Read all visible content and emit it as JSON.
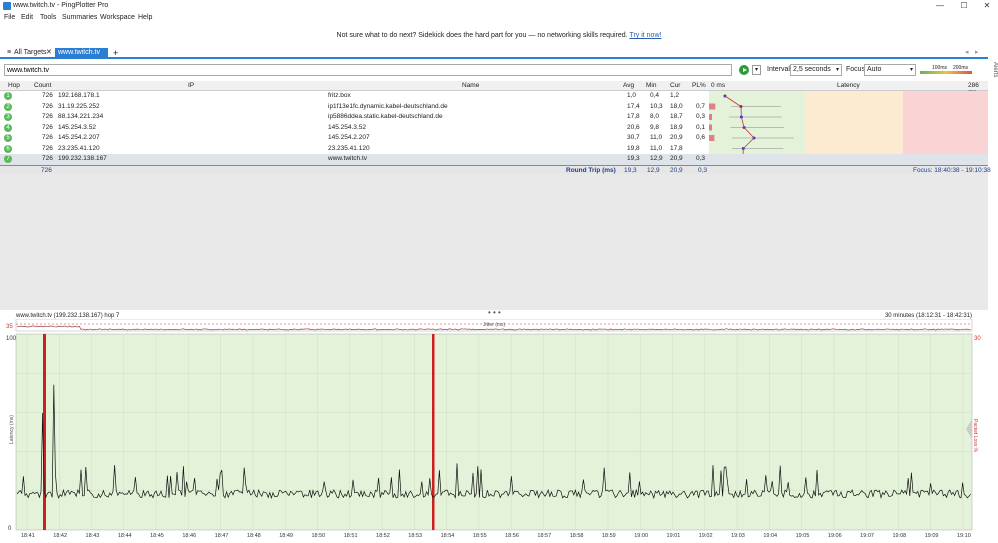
{
  "window": {
    "title": "www.twitch.tv - PingPlotter Pro",
    "controls": [
      "—",
      "☐",
      "✕"
    ]
  },
  "menu": [
    "File",
    "Edit",
    "Tools",
    "Summaries",
    "Workspace",
    "Help"
  ],
  "banner": {
    "text": "Not sure what to do next? Sidekick does the hard part for you — no networking skills required.",
    "link": "Try it now!"
  },
  "tabs": {
    "all_targets": "All Targets",
    "close": "✕",
    "active": "www.twitch.tv",
    "check": "✓",
    "add": "+"
  },
  "alerts": "Alerts",
  "toolbar": {
    "target": "www.twitch.tv",
    "interval_label": "Interval",
    "interval_value": "2,5 seconds",
    "focus_label": "Focus",
    "focus_value": "Auto",
    "scale_100": "100ms",
    "scale_200": "200ms"
  },
  "columns": {
    "hop": "Hop",
    "count": "Count",
    "ip": "IP",
    "name": "Name",
    "avg": "Avg",
    "min": "Min",
    "cur": "Cur",
    "pl": "PL%",
    "zero": "0 ms",
    "latency": "Latency",
    "max": "286 ms"
  },
  "hops": [
    {
      "hop": "1",
      "count": "726",
      "ip": "192.168.178.1",
      "name": "fritz.box",
      "avg": "1,0",
      "min": "0,4",
      "cur": "1,2",
      "pl": ""
    },
    {
      "hop": "2",
      "count": "726",
      "ip": "31.19.225.252",
      "name": "ip1f13e1fc.dynamic.kabel-deutschland.de",
      "avg": "17,4",
      "min": "10,3",
      "cur": "18,0",
      "pl": "0,7"
    },
    {
      "hop": "3",
      "count": "726",
      "ip": "88.134.221.234",
      "name": "ip5886ddea.static.kabel-deutschland.de",
      "avg": "17,8",
      "min": "8,0",
      "cur": "18,7",
      "pl": "0,3"
    },
    {
      "hop": "4",
      "count": "726",
      "ip": "145.254.3.52",
      "name": "145.254.3.52",
      "avg": "20,6",
      "min": "9,8",
      "cur": "18,9",
      "pl": "0,1"
    },
    {
      "hop": "5",
      "count": "726",
      "ip": "145.254.2.207",
      "name": "145.254.2.207",
      "avg": "30,7",
      "min": "11,0",
      "cur": "20,9",
      "pl": "0,6"
    },
    {
      "hop": "6",
      "count": "726",
      "ip": "23.235.41.120",
      "name": "23.235.41.120",
      "avg": "19,8",
      "min": "11,0",
      "cur": "17,8",
      "pl": ""
    },
    {
      "hop": "7",
      "count": "726",
      "ip": "199.232.138.167",
      "name": "www.twitch.tv",
      "avg": "19,3",
      "min": "12,9",
      "cur": "20,9",
      "pl": "0,3"
    }
  ],
  "round_trip": {
    "count": "726",
    "label": "Round Trip (ms)",
    "avg": "19,3",
    "min": "12,9",
    "cur": "20,9",
    "pl": "0,3",
    "focus": "Focus: 18:40:38 - 19:10:38"
  },
  "graph": {
    "title": "www.twitch.tv (199.232.138.167) hop 7",
    "range": "30 minutes (18:12:31 - 18:42:31)",
    "jitter_label": "Jitter (ms)",
    "jitter_max": "35",
    "y_max": "100",
    "y_mid": "50 ms",
    "y_zero": "0",
    "y_label": "Latency (ms)",
    "right_max": "30",
    "right_label": "Packet Loss %",
    "x_labels": [
      "18:41",
      "18:42",
      "18:43",
      "18:44",
      "18:45",
      "18:46",
      "18:47",
      "18:48",
      "18:49",
      "18:50",
      "18:51",
      "18:52",
      "18:53",
      "18:54",
      "18:55",
      "18:56",
      "18:57",
      "18:58",
      "18:59",
      "19:00",
      "19:01",
      "19:02",
      "19:03",
      "19:04",
      "19:05",
      "19:06",
      "19:07",
      "19:08",
      "19:09",
      "19:10"
    ]
  },
  "colors": {
    "accent": "#2a7fd4",
    "green": "#e3f2d9",
    "yellow": "#fcebd0",
    "red": "#fad4d4",
    "loss": "#cc1f1f",
    "hop": "#5cb85c"
  }
}
